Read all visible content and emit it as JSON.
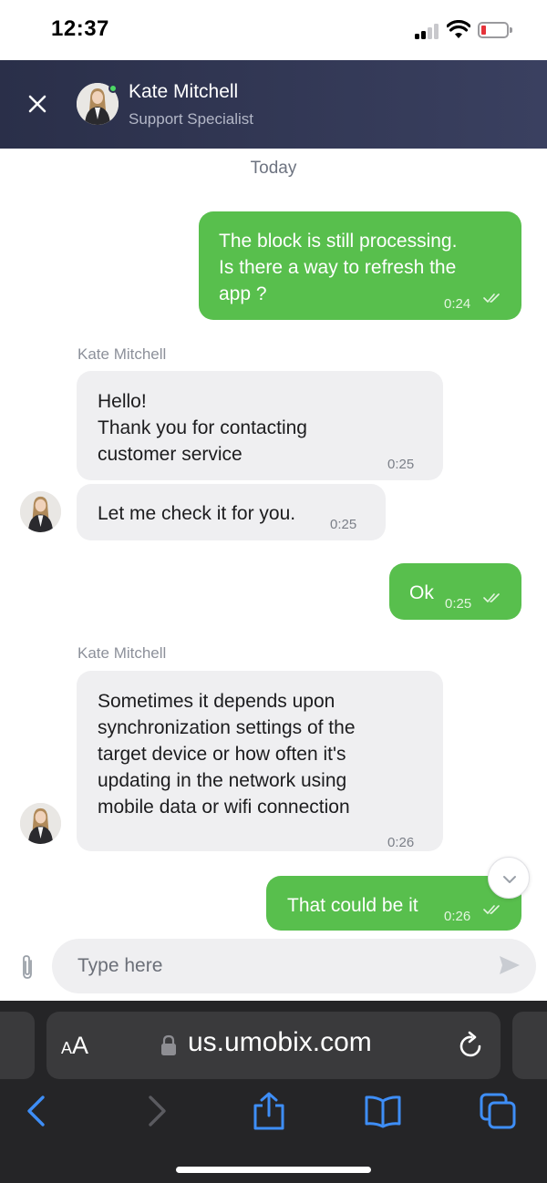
{
  "status_bar": {
    "time": "12:37"
  },
  "header": {
    "close_icon": "close-icon",
    "agent_name": "Kate Mitchell",
    "agent_role": "Support Specialist",
    "online": true
  },
  "chat": {
    "day_label": "Today",
    "messages": [
      {
        "direction": "outgoing",
        "text": "The block is still processing.\nIs there a way to refresh the\napp ?",
        "time": "0:24",
        "read": true
      },
      {
        "direction": "incoming",
        "sender": "Kate Mitchell",
        "text": "Hello!\nThank you for contacting\ncustomer service",
        "time": "0:25"
      },
      {
        "direction": "incoming",
        "text": "Let me check it for you.",
        "time": "0:25"
      },
      {
        "direction": "outgoing",
        "text": "Ok",
        "time": "0:25",
        "read": true
      },
      {
        "direction": "incoming",
        "sender": "Kate Mitchell",
        "text": "Sometimes it depends upon\nsynchronization settings of the\ntarget device or how often it's\nupdating in the network using\nmobile data or wifi connection",
        "time": "0:26"
      },
      {
        "direction": "outgoing",
        "text": "That could be it",
        "time": "0:26",
        "read": true
      }
    ]
  },
  "composer": {
    "placeholder": "Type here",
    "value": ""
  },
  "browser": {
    "text_size_small": "A",
    "text_size_big": "A",
    "url": "us.umobix.com"
  },
  "colors": {
    "header_bg": "#2d3250",
    "outgoing_bubble": "#58bf4d",
    "incoming_bubble": "#efeff1",
    "online_dot": "#4cd964",
    "browser_bg": "#252527",
    "browser_accent": "#3e8ef7"
  }
}
